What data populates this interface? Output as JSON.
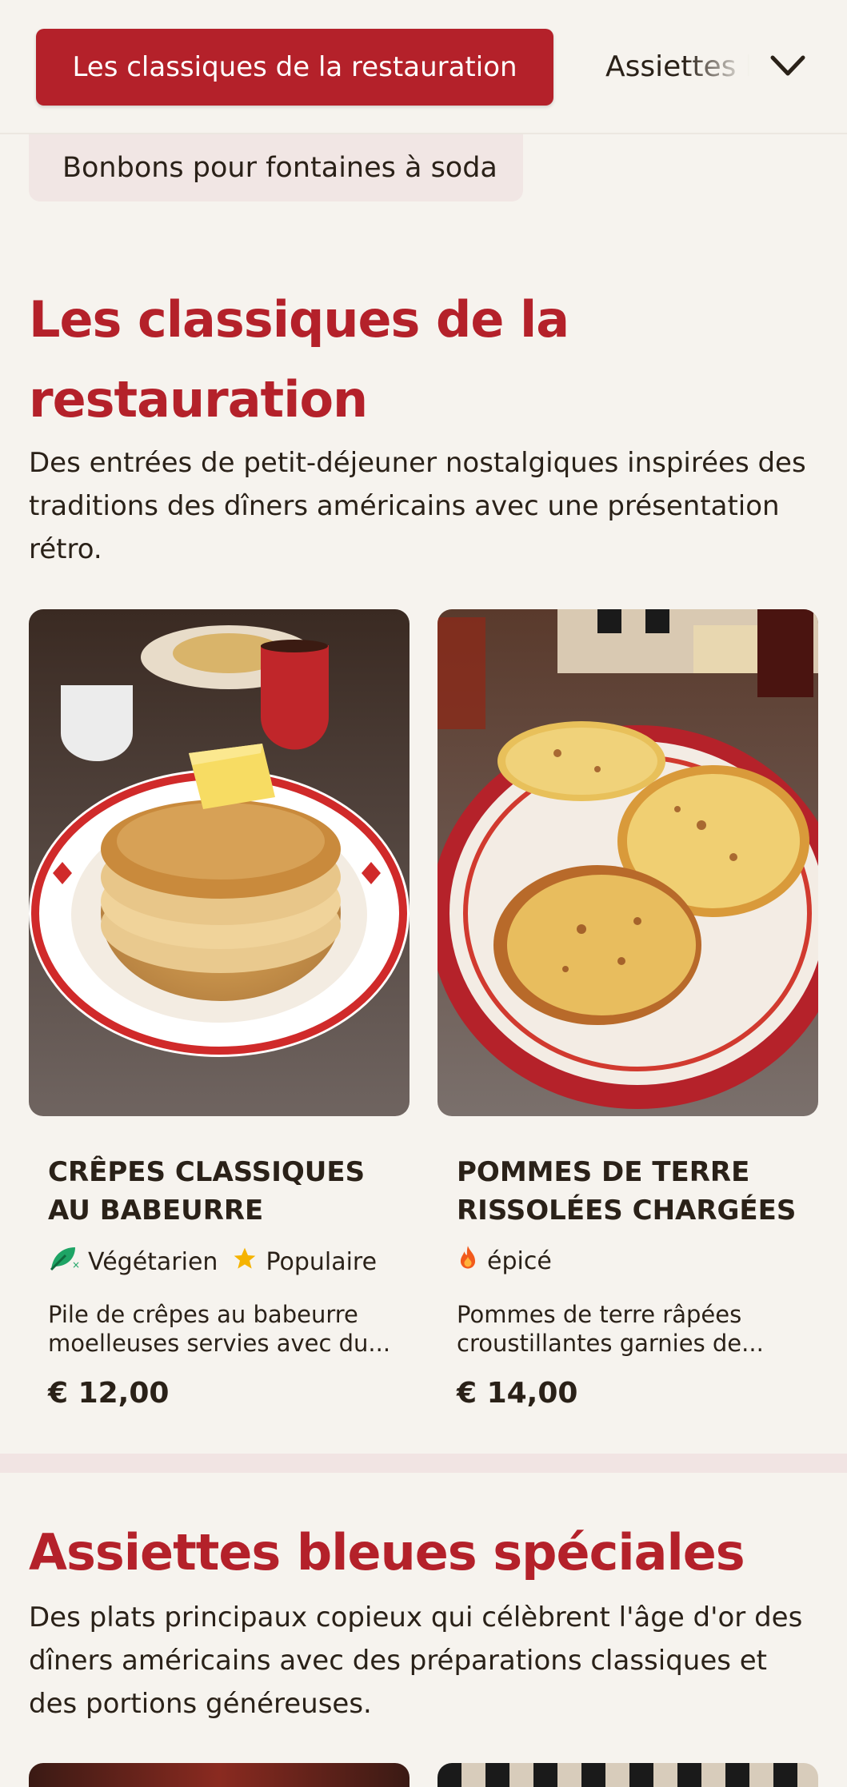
{
  "header": {
    "active_category": "Les classiques de la restauration",
    "next_category": "Assiettes bleues spéciales",
    "dropdown_item": "Bonbons pour fontaines à soda"
  },
  "sections": [
    {
      "title": "Les classiques de la restauration",
      "description": "Des entrées de petit-déjeuner nostalgiques inspirées des traditions des dîners américains avec une présentation rétro.",
      "items": [
        {
          "name": "CRÊPES CLASSIQUES AU BABEURRE",
          "tags": [
            {
              "label": "Végétarien",
              "icon": "leaf-icon"
            },
            {
              "label": "Populaire",
              "icon": "star-icon"
            }
          ],
          "description": "Pile de crêpes au babeurre moelleuses servies avec du...",
          "price": "€ 12,00"
        },
        {
          "name": "POMMES DE TERRE RISSOLÉES CHARGÉES",
          "tags": [
            {
              "label": "épicé",
              "icon": "flame-icon"
            }
          ],
          "description": "Pommes de terre râpées croustillantes garnies de...",
          "price": "€ 14,00"
        }
      ]
    },
    {
      "title": "Assiettes bleues spéciales",
      "description": "Des plats principaux copieux qui célèbrent l'âge d'or des dîners américains avec des préparations classiques et des portions généreuses."
    }
  ],
  "colors": {
    "accent": "#b4212a",
    "background": "#f6f3ee",
    "dropdown_bg": "#f1e6e4"
  }
}
